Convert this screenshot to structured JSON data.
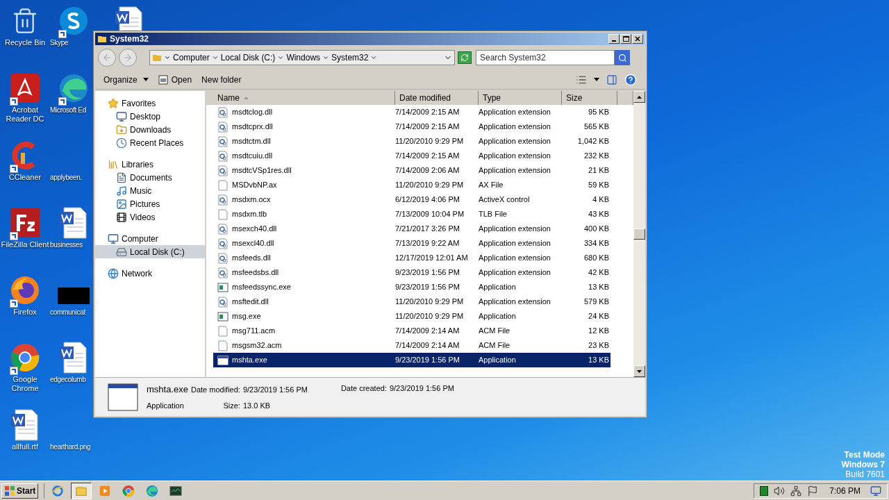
{
  "desktop": {
    "columns": [
      [
        {
          "label": "Recycle Bin",
          "kind": "recycle"
        },
        {
          "label": "Acrobat Reader DC",
          "kind": "acrobat"
        },
        {
          "label": "CCleaner",
          "kind": "ccleaner"
        },
        {
          "label": "FileZilla Client",
          "kind": "filezilla"
        },
        {
          "label": "Firefox",
          "kind": "firefox"
        },
        {
          "label": "Google Chrome",
          "kind": "chrome"
        },
        {
          "label": "allfull.rtf",
          "kind": "word"
        }
      ],
      [
        {
          "label": "Skype",
          "kind": "skype"
        },
        {
          "label": "Microsoft Ed",
          "kind": "edge"
        },
        {
          "label": "applybeen.",
          "kind": "blank"
        },
        {
          "label": "businesses",
          "kind": "word"
        },
        {
          "label": "communicat",
          "kind": "redacted"
        },
        {
          "label": "edgecolumb",
          "kind": "word"
        },
        {
          "label": "hearthard.png",
          "kind": "blank"
        }
      ]
    ],
    "watermark_lines": [
      "Test Mode",
      "Windows 7",
      "Build 7601"
    ]
  },
  "window": {
    "title": "System32",
    "address": [
      "Computer",
      "Local Disk (C:)",
      "Windows",
      "System32"
    ],
    "search": {
      "placeholder": "Search System32"
    },
    "toolbar": [
      {
        "label": "Organize",
        "kind": "menu"
      },
      {
        "label": "Open",
        "kind": "open"
      },
      {
        "label": "New folder",
        "kind": "plain"
      }
    ],
    "nav": [
      {
        "label": "Favorites",
        "kind": "star",
        "selected": false,
        "children": [
          {
            "label": "Desktop",
            "kind": "desktop",
            "selected": false
          },
          {
            "label": "Downloads",
            "kind": "downloads",
            "selected": false
          },
          {
            "label": "Recent Places",
            "kind": "recent",
            "selected": false
          }
        ]
      },
      {
        "label": "Libraries",
        "kind": "library",
        "selected": false,
        "children": [
          {
            "label": "Documents",
            "kind": "documents",
            "selected": false
          },
          {
            "label": "Music",
            "kind": "music",
            "selected": false
          },
          {
            "label": "Pictures",
            "kind": "pictures",
            "selected": false
          },
          {
            "label": "Videos",
            "kind": "videos",
            "selected": false
          }
        ]
      },
      {
        "label": "Computer",
        "kind": "computer",
        "selected": false,
        "children": [
          {
            "label": "Local Disk (C:)",
            "kind": "disk",
            "selected": true
          }
        ]
      },
      {
        "label": "Network",
        "kind": "network",
        "selected": false
      }
    ],
    "columns": [
      "Name",
      "Date modified",
      "Type",
      "Size"
    ],
    "rows": [
      {
        "name": "msdtclog.dll",
        "date": "7/14/2009 2:15 AM",
        "type": "Application extension",
        "size": "95 KB",
        "kind": "dll",
        "selected": false
      },
      {
        "name": "msdtcprx.dll",
        "date": "7/14/2009 2:15 AM",
        "type": "Application extension",
        "size": "565 KB",
        "kind": "dll",
        "selected": false
      },
      {
        "name": "msdtctm.dll",
        "date": "11/20/2010 9:29 PM",
        "type": "Application extension",
        "size": "1,042 KB",
        "kind": "dll",
        "selected": false
      },
      {
        "name": "msdtcuiu.dll",
        "date": "7/14/2009 2:15 AM",
        "type": "Application extension",
        "size": "232 KB",
        "kind": "dll",
        "selected": false
      },
      {
        "name": "msdtcVSp1res.dll",
        "date": "7/14/2009 2:06 AM",
        "type": "Application extension",
        "size": "21 KB",
        "kind": "dll",
        "selected": false
      },
      {
        "name": "MSDvbNP.ax",
        "date": "11/20/2010 9:29 PM",
        "type": "AX File",
        "size": "59 KB",
        "kind": "file",
        "selected": false
      },
      {
        "name": "msdxm.ocx",
        "date": "6/12/2019 4:06 PM",
        "type": "ActiveX control",
        "size": "4 KB",
        "kind": "dll",
        "selected": false
      },
      {
        "name": "msdxm.tlb",
        "date": "7/13/2009 10:04 PM",
        "type": "TLB File",
        "size": "43 KB",
        "kind": "file",
        "selected": false
      },
      {
        "name": "msexch40.dll",
        "date": "7/21/2017 3:26 PM",
        "type": "Application extension",
        "size": "400 KB",
        "kind": "dll",
        "selected": false
      },
      {
        "name": "msexcl40.dll",
        "date": "7/13/2019 9:22 AM",
        "type": "Application extension",
        "size": "334 KB",
        "kind": "dll",
        "selected": false
      },
      {
        "name": "msfeeds.dll",
        "date": "12/17/2019 12:01 AM",
        "type": "Application extension",
        "size": "680 KB",
        "kind": "dll",
        "selected": false
      },
      {
        "name": "msfeedsbs.dll",
        "date": "9/23/2019 1:56 PM",
        "type": "Application extension",
        "size": "42 KB",
        "kind": "dll",
        "selected": false
      },
      {
        "name": "msfeedssync.exe",
        "date": "9/23/2019 1:56 PM",
        "type": "Application",
        "size": "13 KB",
        "kind": "exe",
        "selected": false
      },
      {
        "name": "msftedit.dll",
        "date": "11/20/2010 9:29 PM",
        "type": "Application extension",
        "size": "579 KB",
        "kind": "dll",
        "selected": false
      },
      {
        "name": "msg.exe",
        "date": "11/20/2010 9:29 PM",
        "type": "Application",
        "size": "24 KB",
        "kind": "exe",
        "selected": false
      },
      {
        "name": "msg711.acm",
        "date": "7/14/2009 2:14 AM",
        "type": "ACM File",
        "size": "12 KB",
        "kind": "file",
        "selected": false
      },
      {
        "name": "msgsm32.acm",
        "date": "7/14/2009 2:14 AM",
        "type": "ACM File",
        "size": "23 KB",
        "kind": "file",
        "selected": false
      },
      {
        "name": "mshta.exe",
        "date": "9/23/2019 1:56 PM",
        "type": "Application",
        "size": "13 KB",
        "kind": "app",
        "selected": true
      }
    ],
    "details": {
      "name": "mshta.exe",
      "type": "Application",
      "fields": [
        {
          "label": "Date modified:",
          "value": "9/23/2019 1:56 PM"
        },
        {
          "label": "Size:",
          "value": "13.0 KB"
        },
        {
          "label": "Date created:",
          "value": "9/23/2019 1:56 PM"
        }
      ]
    }
  },
  "taskbar": {
    "start": "Start",
    "apps": [
      {
        "kind": "ie",
        "selected": false
      },
      {
        "kind": "explorer",
        "selected": true
      },
      {
        "kind": "media",
        "selected": false
      },
      {
        "kind": "chrome",
        "selected": false
      },
      {
        "kind": "edge",
        "selected": false
      },
      {
        "kind": "task",
        "selected": false
      }
    ],
    "time": "7:06 PM"
  }
}
